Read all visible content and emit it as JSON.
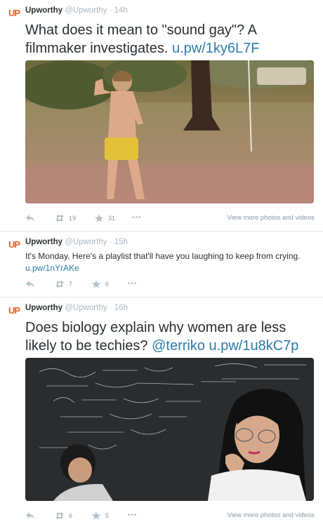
{
  "tweets": [
    {
      "avatar": "UP",
      "name": "Upworthy",
      "handle": "@Upworthy",
      "separator": "·",
      "time": "14h",
      "text": "What does it mean to \"sound gay\"? A filmmaker investigates.",
      "link": "u.pw/1ky6L7F",
      "retweets": "19",
      "favorites": "31",
      "more": "•••",
      "view_more": "View more photos and videos"
    },
    {
      "avatar": "UP",
      "name": "Upworthy",
      "handle": "@Upworthy",
      "separator": "·",
      "time": "15h",
      "text": "It's Monday. Here's a playlist that'll have you laughing to keep from crying.",
      "link": "u.pw/1nYrAKe",
      "retweets": "7",
      "favorites": "6",
      "more": "•••"
    },
    {
      "avatar": "UP",
      "name": "Upworthy",
      "handle": "@Upworthy",
      "separator": "·",
      "time": "16h",
      "text": "Does biology explain why women are less likely to be techies?",
      "mention": "@terriko",
      "link": "u.pw/1u8kC7p",
      "retweets": "6",
      "favorites": "5",
      "more": "•••",
      "view_more": "View more photos and videos"
    }
  ],
  "icons": {
    "reply": "reply-arrow-icon",
    "retweet": "retweet-icon",
    "favorite": "star-icon",
    "more": "more-dots-icon"
  },
  "colors": {
    "brand": "#f15a24",
    "link": "#2c7ba8",
    "muted": "#aab8c2",
    "action": "#8899a6"
  }
}
